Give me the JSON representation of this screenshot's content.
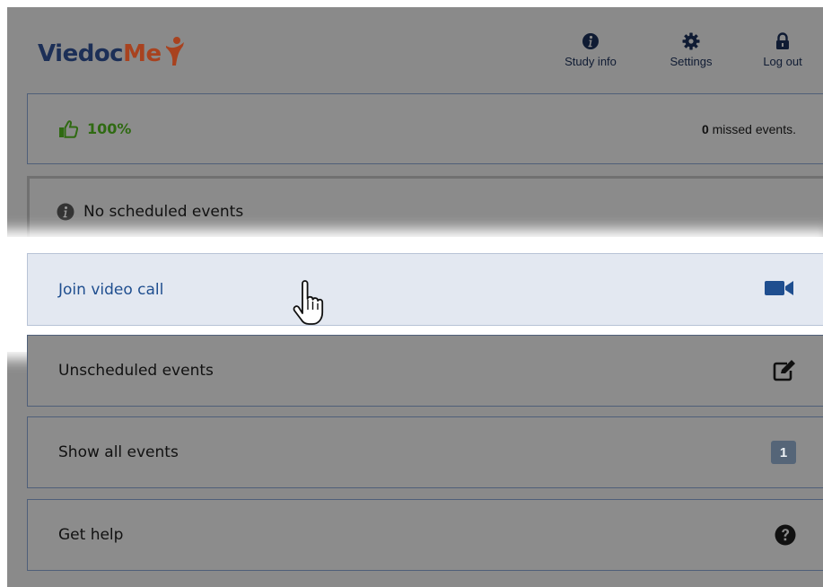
{
  "header": {
    "logo": {
      "part1": "Viedoc",
      "part2": "Me"
    },
    "nav": [
      {
        "label": "Study info",
        "icon": "info-circle-icon"
      },
      {
        "label": "Settings",
        "icon": "gear-icon"
      },
      {
        "label": "Log out",
        "icon": "lock-icon"
      }
    ]
  },
  "progress": {
    "icon": "thumbs-up-icon",
    "percent": "100%",
    "missed_count": "0",
    "missed_text": "missed events."
  },
  "no_events": {
    "icon": "info-circle-icon",
    "label": "No scheduled events"
  },
  "video_call": {
    "label": "Join video call",
    "icon": "video-camera-icon"
  },
  "unscheduled": {
    "label": "Unscheduled events",
    "icon": "edit-icon"
  },
  "all_events": {
    "label": "Show all events",
    "count": "1"
  },
  "help": {
    "label": "Get help",
    "icon": "question-circle-icon"
  },
  "colors": {
    "overlay": "#8a8a8a",
    "brand_navy": "#1c2f57",
    "brand_orange": "#a8421f",
    "success_green": "#2f6a12",
    "link_blue": "#1f4e8f",
    "highlight_bg": "#e3e8f1"
  }
}
